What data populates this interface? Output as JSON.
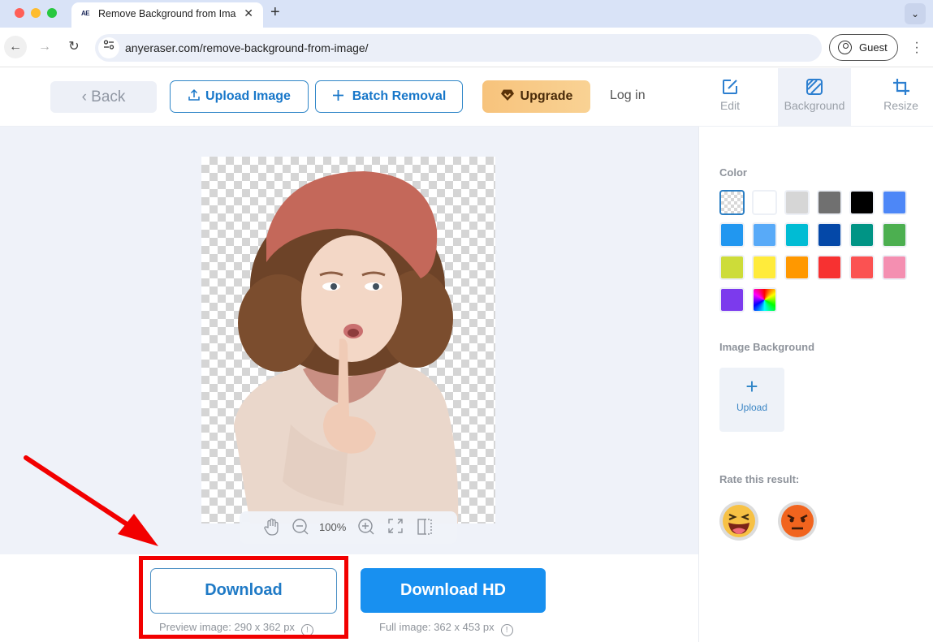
{
  "browser": {
    "tab_title": "Remove Background from Ima",
    "tab_favicon": "AE",
    "url": "anyeraser.com/remove-background-from-image/",
    "profile_label": "Guest"
  },
  "header": {
    "back_label": "Back",
    "upload_label": "Upload Image",
    "batch_label": "Batch Removal",
    "upgrade_label": "Upgrade",
    "login_label": "Log in",
    "tools": [
      {
        "label": "Edit",
        "icon": "edit-icon",
        "active": false
      },
      {
        "label": "Background",
        "icon": "background-icon",
        "active": true
      },
      {
        "label": "Resize",
        "icon": "crop-icon",
        "active": false
      }
    ]
  },
  "canvas": {
    "zoom_level": "100%",
    "controls": [
      "hand-icon",
      "zoom-out-icon",
      "zoom-in-icon",
      "fullscreen-icon",
      "compare-icon"
    ]
  },
  "sidebar": {
    "color_title": "Color",
    "colors": [
      {
        "name": "transparent",
        "hex": "transparent",
        "selected": true
      },
      {
        "name": "white",
        "hex": "#ffffff"
      },
      {
        "name": "light-gray",
        "hex": "#d6d6d6"
      },
      {
        "name": "gray",
        "hex": "#707070"
      },
      {
        "name": "black",
        "hex": "#000000"
      },
      {
        "name": "cornflower-blue",
        "hex": "#4d87f7"
      },
      {
        "name": "blue",
        "hex": "#2197f0"
      },
      {
        "name": "light-blue",
        "hex": "#58aaf8"
      },
      {
        "name": "cyan",
        "hex": "#00bcd4"
      },
      {
        "name": "navy",
        "hex": "#0448a8"
      },
      {
        "name": "teal",
        "hex": "#009485"
      },
      {
        "name": "green",
        "hex": "#4caf50"
      },
      {
        "name": "lime",
        "hex": "#cddc39"
      },
      {
        "name": "yellow",
        "hex": "#ffeb3b"
      },
      {
        "name": "orange",
        "hex": "#ff9800"
      },
      {
        "name": "red",
        "hex": "#f73131"
      },
      {
        "name": "coral",
        "hex": "#fb5252"
      },
      {
        "name": "pink",
        "hex": "#f48fb1"
      },
      {
        "name": "purple",
        "hex": "#7c3aed"
      },
      {
        "name": "rainbow",
        "hex": "rainbow"
      }
    ],
    "image_bg_title": "Image Background",
    "upload_label": "Upload",
    "rate_title": "Rate this result:",
    "ratings": [
      "laughing-emoji",
      "angry-emoji"
    ]
  },
  "download": {
    "download_label": "Download",
    "download_hd_label": "Download HD",
    "preview_note": "Preview image: 290 x 362 px",
    "full_note": "Full image: 362 x 453 px"
  },
  "annotation": {
    "highlight_color": "#f20000"
  }
}
